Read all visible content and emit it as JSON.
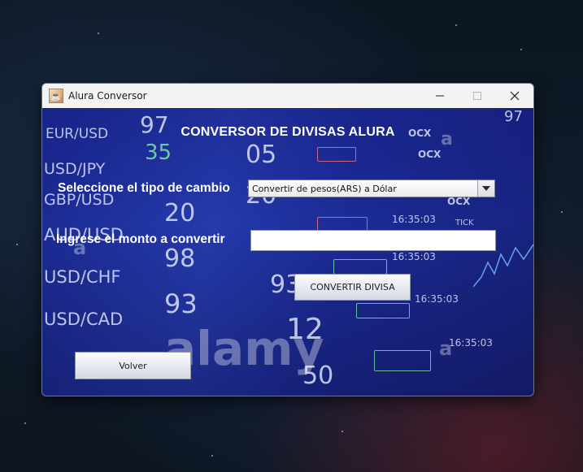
{
  "window": {
    "title": "Alura Conversor",
    "app_icon": "java-cup-icon",
    "controls": {
      "minimize_glyph": "—",
      "maximize_glyph": "☐",
      "close_glyph": "✕"
    }
  },
  "form": {
    "title": "CONVERSOR DE DIVISAS ALURA",
    "type_label": "Seleccione el tipo de cambio",
    "type_selected": "Convertir de pesos(ARS) a Dólar",
    "amount_label": "Ingrese el monto a convertir",
    "amount_value": "",
    "convert_button": "CONVERTIR DIVISA",
    "back_button": "Volver"
  },
  "background_image": {
    "currency_pairs": [
      "EUR/USD",
      "USD/JPY",
      "GBP/USD",
      "AUD/USD",
      "USD/CHF",
      "USD/CAD"
    ],
    "watermark": "alamy"
  }
}
